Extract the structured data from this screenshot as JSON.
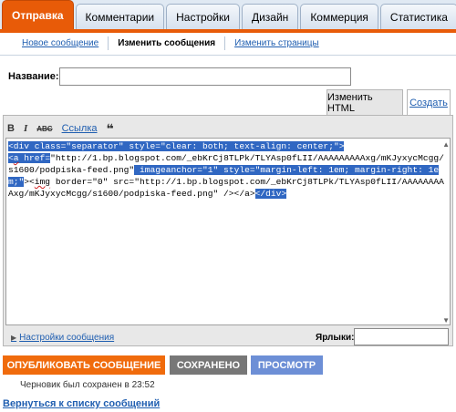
{
  "top_tabs": [
    "Отправка",
    "Комментарии",
    "Настройки",
    "Дизайн",
    "Коммерция",
    "Статистика"
  ],
  "sub_tabs": [
    "Новое сообщение",
    "Изменить сообщения",
    "Изменить страницы"
  ],
  "title_label": "Название:",
  "title_value": "",
  "editor_tabs": {
    "html": "Изменить HTML",
    "compose": "Создать"
  },
  "toolbar": {
    "bold": "B",
    "italic": "I",
    "spell": "ABC",
    "link": "Ссылка",
    "quote": "❝"
  },
  "code": {
    "sel1": "<div class=\"separator\" style=\"clear: both; text-align: center;\">\n<",
    "sq1": "a",
    "sel2": " href=",
    "seg2": "\"http://1.bp.blogspot.com/_ebKrCj8TLPk/TLYAsp0fLII/AAAAAAAAAxg/mKJyxycMcgg/s1600/podpiska-feed.png\"",
    "sel3": " imageanchor=\"1\" style=\"margin-left: 1em; margin-right: 1em;\"",
    "seg4": "><",
    "sq2": "img",
    "seg5": " border=\"0\" src=\"http://1.bp.blogspot.com/_ebKrCj8TLPk/TLYAsp0fLII/AAAAAAAAAxg/mKJyxycMcgg/s1600/podpiska-feed.png\" /></a>",
    "sel4": "</div>"
  },
  "settings_link": "Настройки сообщения",
  "labels_label": "Ярлыки:",
  "labels_value": "",
  "buttons": {
    "publish": "ОПУБЛИКОВАТЬ СООБЩЕНИЕ",
    "saved": "СОХРАНЕНО",
    "preview": "ПРОСМОТР"
  },
  "draft_note": "Черновик был сохранен в 23:52",
  "back_link": "Вернуться к списку сообщений"
}
